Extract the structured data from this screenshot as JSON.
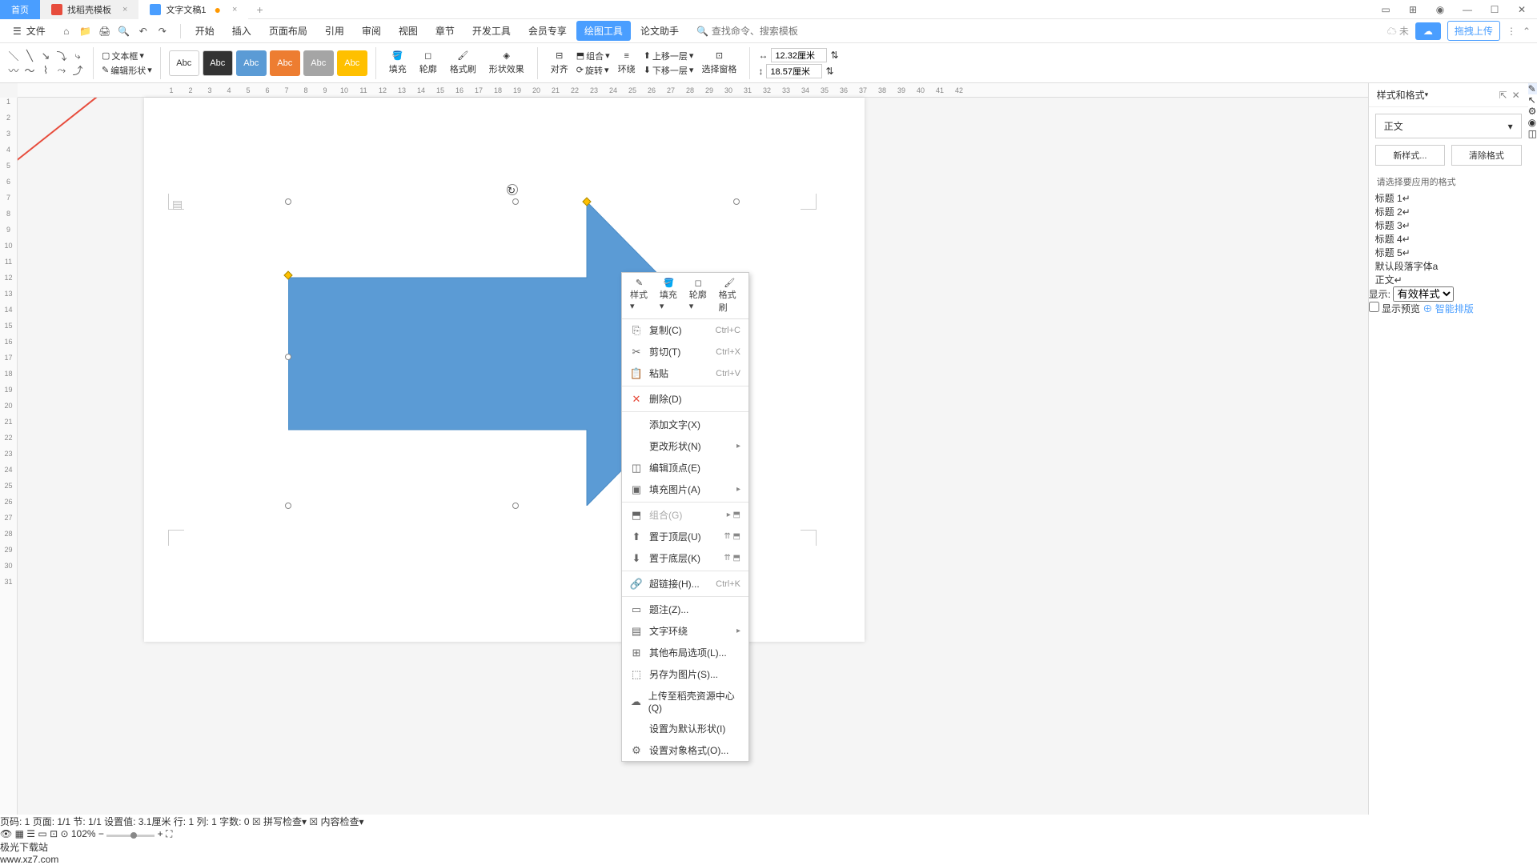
{
  "tabs": {
    "home": "首页",
    "template": "找稻壳模板",
    "doc": "文字文稿1",
    "modified": "●"
  },
  "menu": {
    "file": "文件",
    "tabs": [
      "开始",
      "插入",
      "页面布局",
      "引用",
      "审阅",
      "视图",
      "章节",
      "开发工具",
      "会员专享",
      "绘图工具",
      "论文助手"
    ],
    "active_index": 9,
    "search_placeholder": "查找命令、搜索模板",
    "unsaved": "未",
    "upload": "拖拽上传"
  },
  "ribbon": {
    "textbox": "文本框",
    "textbox_dd": "▾",
    "edit_shape": "编辑形状",
    "edit_shape_dd": "▾",
    "swatch_label": "Abc",
    "fill": "填充",
    "outline": "轮廓",
    "format_painter": "格式刷",
    "shape_effects": "形状效果",
    "align": "对齐",
    "group": "组合",
    "rotate": "旋转",
    "wrap": "环绕",
    "bring_forward": "上移一层",
    "send_backward": "下移一层",
    "selection_pane": "选择窗格",
    "width_value": "12.32厘米",
    "height_value": "18.57厘米"
  },
  "ctx_toolbar": [
    "样式",
    "填充",
    "轮廓",
    "格式刷"
  ],
  "context_menu": [
    {
      "icon": "⎘",
      "label": "复制(C)",
      "shortcut": "Ctrl+C"
    },
    {
      "icon": "✂",
      "label": "剪切(T)",
      "shortcut": "Ctrl+X"
    },
    {
      "icon": "📋",
      "label": "粘贴",
      "shortcut": "Ctrl+V"
    },
    {
      "sep": true
    },
    {
      "icon": "✕",
      "label": "删除(D)",
      "red": true
    },
    {
      "sep": true
    },
    {
      "icon": "",
      "label": "添加文字(X)"
    },
    {
      "icon": "",
      "label": "更改形状(N)",
      "sub": true
    },
    {
      "icon": "◫",
      "label": "编辑顶点(E)"
    },
    {
      "icon": "▣",
      "label": "填充图片(A)",
      "sub": true
    },
    {
      "sep": true
    },
    {
      "icon": "⬒",
      "label": "组合(G)",
      "disabled": true,
      "extra": true
    },
    {
      "icon": "⬆",
      "label": "置于顶层(U)",
      "extra2": true
    },
    {
      "icon": "⬇",
      "label": "置于底层(K)",
      "extra2": true
    },
    {
      "sep": true
    },
    {
      "icon": "🔗",
      "label": "超链接(H)...",
      "shortcut": "Ctrl+K"
    },
    {
      "sep": true
    },
    {
      "icon": "▭",
      "label": "题注(Z)..."
    },
    {
      "icon": "▤",
      "label": "文字环绕",
      "sub": true
    },
    {
      "icon": "⊞",
      "label": "其他布局选项(L)..."
    },
    {
      "icon": "⬚",
      "label": "另存为图片(S)..."
    },
    {
      "icon": "☁",
      "label": "上传至稻壳资源中心(Q)"
    },
    {
      "icon": "",
      "label": "设置为默认形状(I)"
    },
    {
      "icon": "⚙",
      "label": "设置对象格式(O)..."
    }
  ],
  "styles_panel": {
    "title": "样式和格式",
    "current": "正文",
    "new_style": "新样式...",
    "clear": "清除格式",
    "apply_label": "请选择要应用的格式",
    "items": [
      "标题 1",
      "标题 2",
      "标题 3",
      "标题 4",
      "标题 5",
      "默认段落字体",
      "正文"
    ],
    "display_label": "显示:",
    "display_value": "有效样式",
    "preview": "显示预览",
    "smart_layout": "智能排版"
  },
  "statusbar": {
    "pages": "页码: 1",
    "page": "页面: 1/1",
    "section": "节: 1/1",
    "set_value": "设置值: 3.1厘米",
    "line": "行: 1",
    "col": "列: 1",
    "chars": "字数: 0",
    "spell": "拼写检查",
    "content": "内容检查",
    "zoom": "102%"
  },
  "ruler_h": [
    1,
    2,
    3,
    4,
    5,
    6,
    7,
    8,
    9,
    10,
    11,
    12,
    13,
    14,
    15,
    16,
    17,
    18,
    19,
    20,
    21,
    22,
    23,
    24,
    25,
    26,
    27,
    28,
    29,
    30,
    31,
    32,
    33,
    34,
    35,
    36,
    37,
    38,
    39,
    40,
    41,
    42
  ],
  "ruler_v": [
    1,
    2,
    3,
    4,
    5,
    6,
    7,
    8,
    9,
    10,
    11,
    12,
    13,
    14,
    15,
    16,
    17,
    18,
    19,
    20,
    21,
    22,
    23,
    24,
    25,
    26,
    27,
    28,
    29,
    30,
    31
  ],
  "watermark": "极光下载站\nwww.xz7.com"
}
